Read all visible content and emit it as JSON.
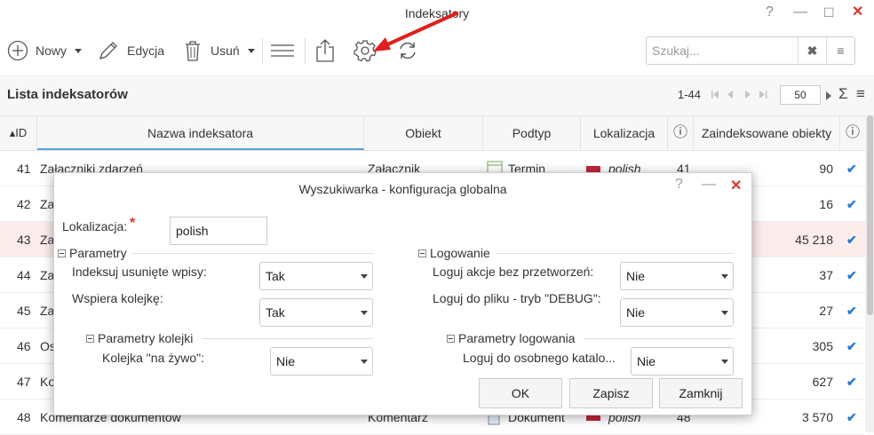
{
  "window": {
    "title": "Indeksatory",
    "help": "?",
    "minimize": "—",
    "maximize": "☐",
    "close": "✕"
  },
  "toolbar": {
    "new_label": "Nowy",
    "edit_label": "Edycja",
    "delete_label": "Usuń",
    "search_placeholder": "Szukaj...",
    "search_clear": "✖",
    "search_menu": "≡"
  },
  "list": {
    "title": "Lista indeksatorów",
    "range": "1-44",
    "page_size": "50",
    "sum_icon": "Σ",
    "menu_icon": "≡"
  },
  "columns": [
    "▴ID",
    "Nazwa indeksatora",
    "Obiekt",
    "Podtyp",
    "Lokalizacja",
    "ⓘ",
    "Zaindeksowane obiekty",
    "ⓘ"
  ],
  "rows": [
    {
      "id": "41",
      "name": "Załączniki zdarzeń",
      "object": "Załącznik",
      "subtype": "Termin",
      "loc": "polish",
      "n": "41",
      "count": "90"
    },
    {
      "id": "42",
      "name": "Za",
      "object": "",
      "subtype": "",
      "loc": "",
      "n": "",
      "count": "16"
    },
    {
      "id": "43",
      "name": "Za",
      "object": "",
      "subtype": "",
      "loc": "",
      "n": "",
      "count": "45 218"
    },
    {
      "id": "44",
      "name": "Za",
      "object": "",
      "subtype": "",
      "loc": "",
      "n": "",
      "count": "37"
    },
    {
      "id": "45",
      "name": "Za",
      "object": "",
      "subtype": "",
      "loc": "",
      "n": "",
      "count": "27"
    },
    {
      "id": "46",
      "name": "Os",
      "object": "",
      "subtype": "",
      "loc": "",
      "n": "",
      "count": "305"
    },
    {
      "id": "47",
      "name": "Ko",
      "object": "",
      "subtype": "",
      "loc": "",
      "n": "",
      "count": "627"
    },
    {
      "id": "48",
      "name": "Komentarze dokumentów",
      "object": "Komentarz",
      "subtype": "Dokument",
      "loc": "polish",
      "n": "48",
      "count": "3 570"
    }
  ],
  "dialog": {
    "title": "Wyszukiwarka - konfiguracja globalna",
    "help": "?",
    "minimize": "—",
    "close": "✕",
    "localization_label": "Lokalizacja:",
    "required_mark": "*",
    "localization_value": "polish",
    "params_group": "Parametry",
    "index_deleted_label": "Indeksuj usunięte wpisy:",
    "index_deleted_value": "Tak",
    "supports_queue_label": "Wspiera kolejkę:",
    "supports_queue_value": "Tak",
    "queue_params_group": "Parametry kolejki",
    "live_queue_label": "Kolejka \"na żywo\":",
    "live_queue_value": "Nie",
    "logging_group": "Logowanie",
    "log_actions_label": "Loguj akcje bez przetworzeń:",
    "log_actions_value": "Nie",
    "log_file_label": "Loguj do pliku - tryb \"DEBUG\":",
    "log_file_value": "Nie",
    "log_params_group": "Parametry logowania",
    "log_dir_label": "Loguj do osobnego katalo...",
    "log_dir_value": "Nie",
    "ok": "OK",
    "save": "Zapisz",
    "close_btn": "Zamknij"
  },
  "colors": {
    "accent": "#2a7bd1",
    "close_red": "#d9342b",
    "arrow_red": "#e0201e",
    "highlight_row": "#fdecec"
  }
}
